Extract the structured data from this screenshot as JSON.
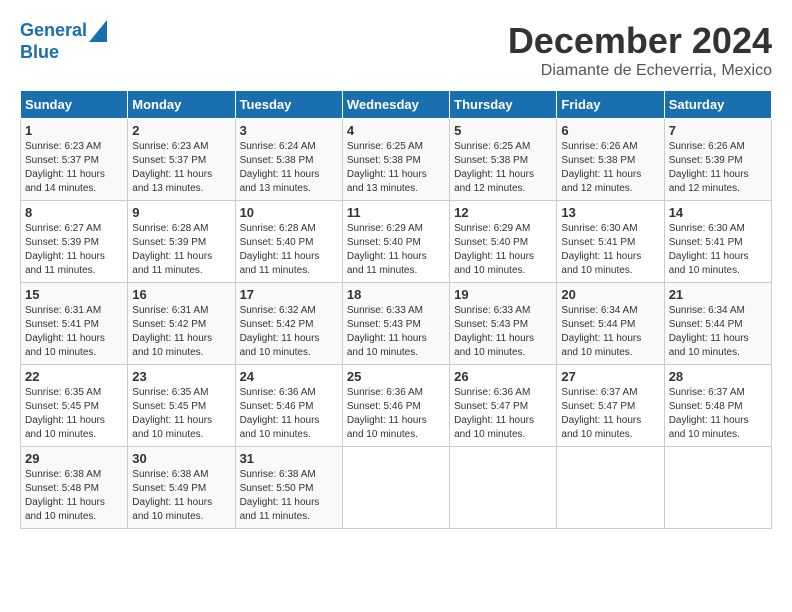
{
  "logo": {
    "line1": "General",
    "line2": "Blue"
  },
  "title": "December 2024",
  "subtitle": "Diamante de Echeverria, Mexico",
  "days_header": [
    "Sunday",
    "Monday",
    "Tuesday",
    "Wednesday",
    "Thursday",
    "Friday",
    "Saturday"
  ],
  "weeks": [
    [
      {
        "day": "1",
        "sunrise": "6:23 AM",
        "sunset": "5:37 PM",
        "daylight": "11 hours and 14 minutes."
      },
      {
        "day": "2",
        "sunrise": "6:23 AM",
        "sunset": "5:37 PM",
        "daylight": "11 hours and 13 minutes."
      },
      {
        "day": "3",
        "sunrise": "6:24 AM",
        "sunset": "5:38 PM",
        "daylight": "11 hours and 13 minutes."
      },
      {
        "day": "4",
        "sunrise": "6:25 AM",
        "sunset": "5:38 PM",
        "daylight": "11 hours and 13 minutes."
      },
      {
        "day": "5",
        "sunrise": "6:25 AM",
        "sunset": "5:38 PM",
        "daylight": "11 hours and 12 minutes."
      },
      {
        "day": "6",
        "sunrise": "6:26 AM",
        "sunset": "5:38 PM",
        "daylight": "11 hours and 12 minutes."
      },
      {
        "day": "7",
        "sunrise": "6:26 AM",
        "sunset": "5:39 PM",
        "daylight": "11 hours and 12 minutes."
      }
    ],
    [
      {
        "day": "8",
        "sunrise": "6:27 AM",
        "sunset": "5:39 PM",
        "daylight": "11 hours and 11 minutes."
      },
      {
        "day": "9",
        "sunrise": "6:28 AM",
        "sunset": "5:39 PM",
        "daylight": "11 hours and 11 minutes."
      },
      {
        "day": "10",
        "sunrise": "6:28 AM",
        "sunset": "5:40 PM",
        "daylight": "11 hours and 11 minutes."
      },
      {
        "day": "11",
        "sunrise": "6:29 AM",
        "sunset": "5:40 PM",
        "daylight": "11 hours and 11 minutes."
      },
      {
        "day": "12",
        "sunrise": "6:29 AM",
        "sunset": "5:40 PM",
        "daylight": "11 hours and 10 minutes."
      },
      {
        "day": "13",
        "sunrise": "6:30 AM",
        "sunset": "5:41 PM",
        "daylight": "11 hours and 10 minutes."
      },
      {
        "day": "14",
        "sunrise": "6:30 AM",
        "sunset": "5:41 PM",
        "daylight": "11 hours and 10 minutes."
      }
    ],
    [
      {
        "day": "15",
        "sunrise": "6:31 AM",
        "sunset": "5:41 PM",
        "daylight": "11 hours and 10 minutes."
      },
      {
        "day": "16",
        "sunrise": "6:31 AM",
        "sunset": "5:42 PM",
        "daylight": "11 hours and 10 minutes."
      },
      {
        "day": "17",
        "sunrise": "6:32 AM",
        "sunset": "5:42 PM",
        "daylight": "11 hours and 10 minutes."
      },
      {
        "day": "18",
        "sunrise": "6:33 AM",
        "sunset": "5:43 PM",
        "daylight": "11 hours and 10 minutes."
      },
      {
        "day": "19",
        "sunrise": "6:33 AM",
        "sunset": "5:43 PM",
        "daylight": "11 hours and 10 minutes."
      },
      {
        "day": "20",
        "sunrise": "6:34 AM",
        "sunset": "5:44 PM",
        "daylight": "11 hours and 10 minutes."
      },
      {
        "day": "21",
        "sunrise": "6:34 AM",
        "sunset": "5:44 PM",
        "daylight": "11 hours and 10 minutes."
      }
    ],
    [
      {
        "day": "22",
        "sunrise": "6:35 AM",
        "sunset": "5:45 PM",
        "daylight": "11 hours and 10 minutes."
      },
      {
        "day": "23",
        "sunrise": "6:35 AM",
        "sunset": "5:45 PM",
        "daylight": "11 hours and 10 minutes."
      },
      {
        "day": "24",
        "sunrise": "6:36 AM",
        "sunset": "5:46 PM",
        "daylight": "11 hours and 10 minutes."
      },
      {
        "day": "25",
        "sunrise": "6:36 AM",
        "sunset": "5:46 PM",
        "daylight": "11 hours and 10 minutes."
      },
      {
        "day": "26",
        "sunrise": "6:36 AM",
        "sunset": "5:47 PM",
        "daylight": "11 hours and 10 minutes."
      },
      {
        "day": "27",
        "sunrise": "6:37 AM",
        "sunset": "5:47 PM",
        "daylight": "11 hours and 10 minutes."
      },
      {
        "day": "28",
        "sunrise": "6:37 AM",
        "sunset": "5:48 PM",
        "daylight": "11 hours and 10 minutes."
      }
    ],
    [
      {
        "day": "29",
        "sunrise": "6:38 AM",
        "sunset": "5:48 PM",
        "daylight": "11 hours and 10 minutes."
      },
      {
        "day": "30",
        "sunrise": "6:38 AM",
        "sunset": "5:49 PM",
        "daylight": "11 hours and 10 minutes."
      },
      {
        "day": "31",
        "sunrise": "6:38 AM",
        "sunset": "5:50 PM",
        "daylight": "11 hours and 11 minutes."
      },
      null,
      null,
      null,
      null
    ]
  ]
}
